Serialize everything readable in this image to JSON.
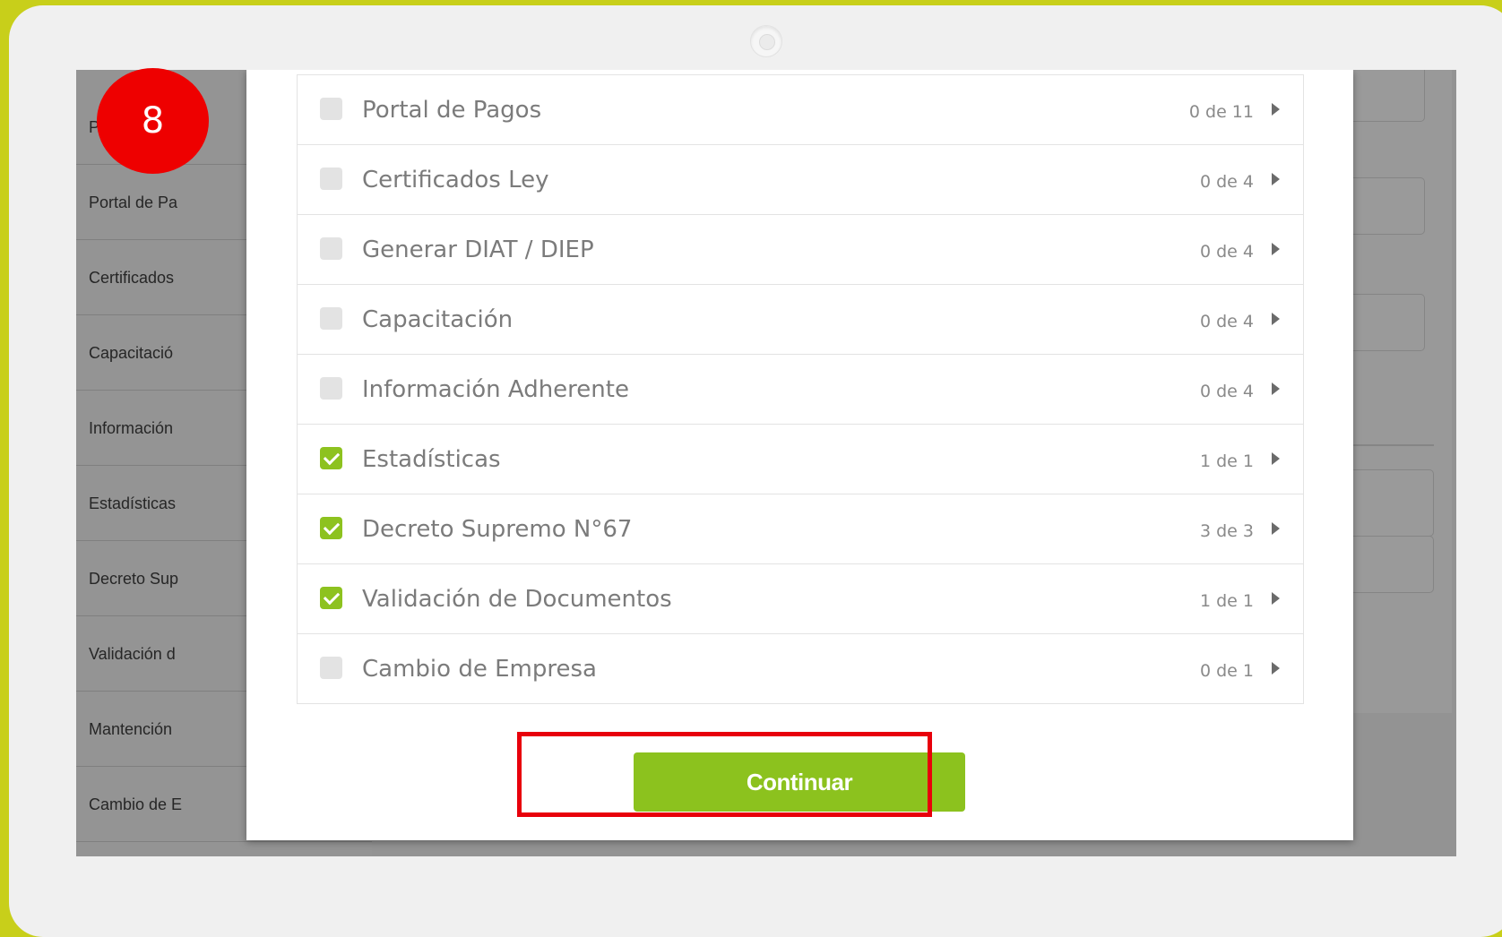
{
  "annotation": {
    "step_number": "8"
  },
  "background": {
    "sidebar_items": [
      "Pr",
      "Portal de Pa",
      "Certificados",
      "Capacitació",
      "Información",
      "Estadísticas",
      "Decreto Sup",
      "Validación d",
      "Mantención",
      "Cambio de E"
    ]
  },
  "modal": {
    "permissions": [
      {
        "label": "Portal de Pagos",
        "count": "0 de 11",
        "checked": false
      },
      {
        "label": "Certificados Ley",
        "count": "0 de 4",
        "checked": false
      },
      {
        "label": "Generar DIAT / DIEP",
        "count": "0 de 4",
        "checked": false
      },
      {
        "label": "Capacitación",
        "count": "0 de 4",
        "checked": false
      },
      {
        "label": "Información Adherente",
        "count": "0 de 4",
        "checked": false
      },
      {
        "label": "Estadísticas",
        "count": "1 de 1",
        "checked": true
      },
      {
        "label": "Decreto Supremo N°67",
        "count": "3 de 3",
        "checked": true
      },
      {
        "label": "Validación de Documentos",
        "count": "1 de 1",
        "checked": true
      },
      {
        "label": "Cambio de Empresa",
        "count": "0 de 1",
        "checked": false
      }
    ],
    "continue_label": "Continuar"
  },
  "colors": {
    "device_frame": "#c8cf1a",
    "accent_green": "#8cc21e",
    "highlight_red": "#e8000b"
  }
}
